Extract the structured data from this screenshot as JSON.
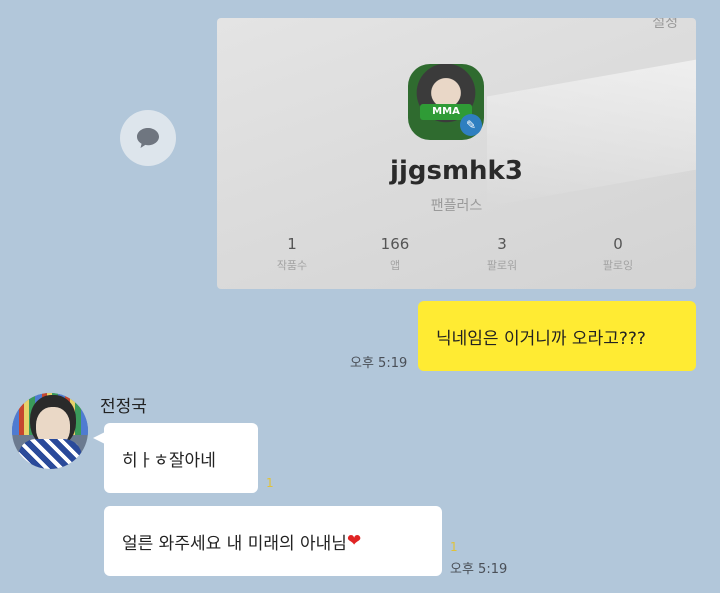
{
  "chat": {
    "shared_photo": {
      "corner_text": "설정",
      "avatar_badge": "MMA",
      "profile_name": "jjgsmhk3",
      "profile_sub": "팬플러스",
      "stats": [
        {
          "value": "1",
          "label": "작품수"
        },
        {
          "value": "166",
          "label": "앱"
        },
        {
          "value": "3",
          "label": "팔로워"
        },
        {
          "value": "0",
          "label": "팔로잉"
        }
      ]
    },
    "share_icon": "chat-bubble-icon",
    "messages": {
      "mine_1": {
        "text": "닉네임은 이거니까 오라고???",
        "time": "오후 5:19"
      },
      "sender_name": "전정국",
      "theirs_1": {
        "text": "히ㅏㅎ잘아네",
        "read_count": "1"
      },
      "theirs_2": {
        "text": "얼른 와주세요 내 미래의 아내님",
        "emoji": "❤",
        "read_count": "1",
        "time": "오후 5:19"
      }
    },
    "colors": {
      "background": "#b2c7da",
      "my_bubble": "#ffeb33",
      "their_bubble": "#ffffff"
    }
  }
}
